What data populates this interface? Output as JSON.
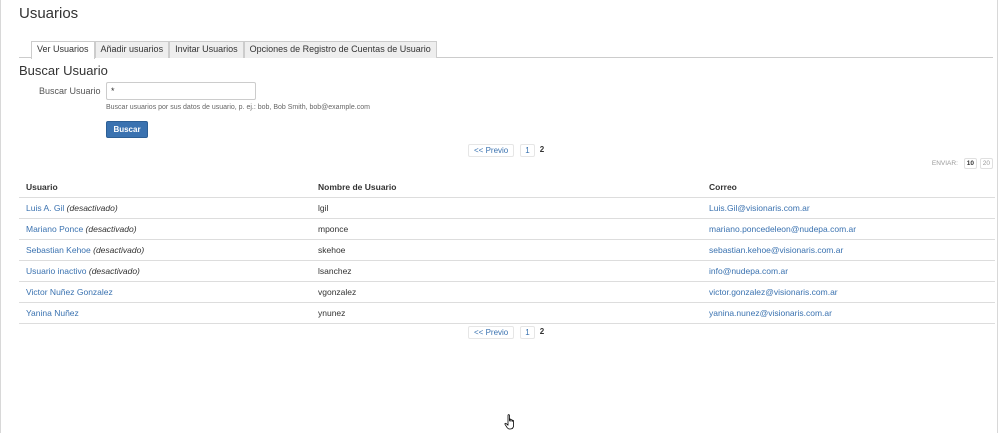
{
  "page": {
    "title": "Usuarios"
  },
  "tabs": [
    {
      "label": "Ver Usuarios",
      "active": true
    },
    {
      "label": "Añadir usuarios",
      "active": false
    },
    {
      "label": "Invitar Usuarios",
      "active": false
    },
    {
      "label": "Opciones de Registro de Cuentas de Usuario",
      "active": false
    }
  ],
  "search": {
    "section_title": "Buscar Usuario",
    "label": "Buscar Usuario",
    "value": "*",
    "help": "Buscar usuarios por sus datos de usuario, p. ej.: bob, Bob Smith, bob@example.com",
    "button_label": "Buscar"
  },
  "pagination": {
    "prev_label": "<< Previo",
    "pages": [
      "1"
    ],
    "current": "2"
  },
  "page_size": {
    "label": "ENVIAR:",
    "options": [
      "10",
      "20"
    ],
    "selected": "10"
  },
  "table": {
    "headers": [
      "Usuario",
      "Nombre de Usuario",
      "Correo"
    ],
    "rows": [
      {
        "name": "Luis A. Gil",
        "status": "(desactivado)",
        "username": "lgil",
        "email": "Luis.Gil@visionaris.com.ar"
      },
      {
        "name": "Mariano Ponce",
        "status": "(desactivado)",
        "username": "mponce",
        "email": "mariano.poncedeleon@nudepa.com.ar"
      },
      {
        "name": "Sebastian Kehoe",
        "status": "(desactivado)",
        "username": "skehoe",
        "email": "sebastian.kehoe@visionaris.com.ar"
      },
      {
        "name": "Usuario inactivo",
        "status": "(desactivado)",
        "username": "lsanchez",
        "email": "info@nudepa.com.ar"
      },
      {
        "name": "Victor Nuñez Gonzalez",
        "status": "",
        "username": "vgonzalez",
        "email": "victor.gonzalez@visionaris.com.ar"
      },
      {
        "name": "Yanina Nuñez",
        "status": "",
        "username": "ynunez",
        "email": "yanina.nunez@visionaris.com.ar"
      }
    ]
  },
  "icons": {
    "cursor": "hand-pointer-icon"
  }
}
